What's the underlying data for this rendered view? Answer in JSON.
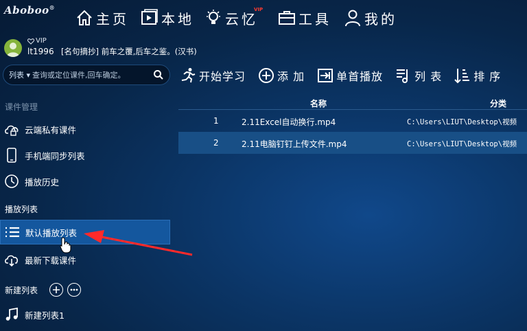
{
  "app": {
    "logo": "Aboboo"
  },
  "nav": {
    "items": [
      {
        "label": "主页",
        "icon": "home-icon"
      },
      {
        "label": "本地",
        "icon": "local-video-icon"
      },
      {
        "label": "云忆",
        "icon": "lightbulb-icon",
        "badge": "VIP"
      },
      {
        "label": "工具",
        "icon": "toolbox-icon"
      },
      {
        "label": "我的",
        "icon": "user-icon"
      }
    ]
  },
  "user": {
    "vip_label": "VIP",
    "username": "lt1996",
    "quote": "[名句摘抄] 前车之覆,后车之鉴。(汉书)"
  },
  "search": {
    "dropdown_label": "列表",
    "placeholder": "查询或定位课件,回车确定。"
  },
  "toolbar": {
    "items": [
      {
        "label": "开始学习",
        "icon": "running-icon"
      },
      {
        "label": "添 加",
        "icon": "add-circle-icon"
      },
      {
        "label": "单首播放",
        "icon": "single-play-icon"
      },
      {
        "label": "列 表",
        "icon": "music-list-icon"
      },
      {
        "label": "排 序",
        "icon": "sort-icon"
      }
    ]
  },
  "sidebar": {
    "section_courseware": "课件管理",
    "cloud_private": "云端私有课件",
    "phone_sync": "手机端同步列表",
    "play_history": "播放历史",
    "section_playlist": "播放列表",
    "default_playlist": "默认播放列表",
    "latest_download": "最新下载课件",
    "section_new_list": "新建列表",
    "new_list_1": "新建列表1"
  },
  "table": {
    "headers": {
      "name": "名称",
      "category": "分类"
    },
    "rows": [
      {
        "no": "1",
        "name": "2.11Excel自动换行.mp4",
        "path": "C:\\Users\\LIUT\\Desktop\\视频",
        "selected": false
      },
      {
        "no": "2",
        "name": "2.11电脑钉钉上传文件.mp4",
        "path": "C:\\Users\\LIUT\\Desktop\\视频",
        "selected": true
      }
    ]
  },
  "colors": {
    "accent_red": "#ff2a2a",
    "active_row": "#14579e",
    "selected_row": "#184f86"
  }
}
